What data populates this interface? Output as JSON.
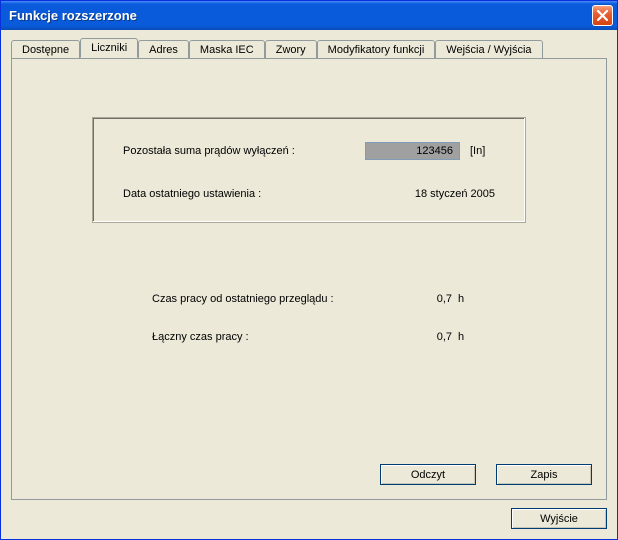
{
  "window": {
    "title": "Funkcje rozszerzone"
  },
  "tabs": {
    "t0": "Dostępne",
    "t1": "Liczniki",
    "t2": "Adres",
    "t3": "Maska IEC",
    "t4": "Zwory",
    "t5": "Modyfikatory funkcji",
    "t6": "Wejścia / Wyjścia"
  },
  "group": {
    "remaining_label": "Pozostała suma prądów wyłączeń :",
    "remaining_value": "123456",
    "remaining_unit": "[In]",
    "last_set_label": "Data ostatniego ustawienia :",
    "last_set_value": "18 styczeń 2005"
  },
  "stats": {
    "since_label": "Czas pracy od ostatniego przeglądu :",
    "since_value": "0,7",
    "total_label": "Łączny czas pracy  :",
    "total_value": "0,7",
    "unit": "h"
  },
  "buttons": {
    "read": "Odczyt",
    "write": "Zapis",
    "exit": "Wyjście"
  }
}
